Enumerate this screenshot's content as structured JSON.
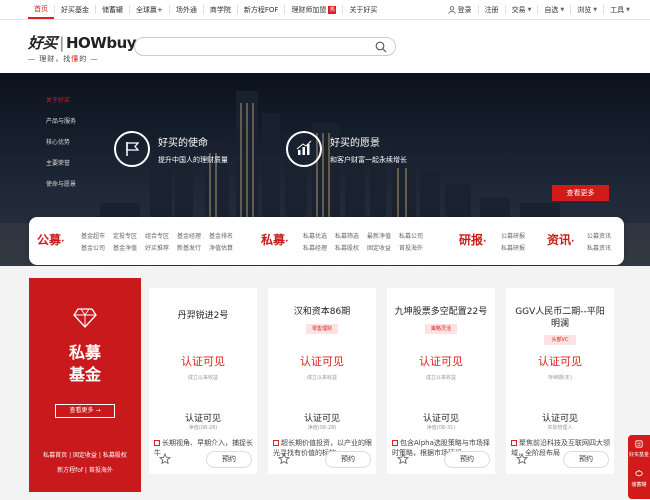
{
  "topnav": {
    "left": [
      {
        "label": "首页",
        "active": true
      },
      {
        "label": "好买基金"
      },
      {
        "label": "储蓄罐"
      },
      {
        "label": "全球赢+"
      },
      {
        "label": "场外通"
      },
      {
        "label": "商学院"
      },
      {
        "label": "新方程FOF"
      },
      {
        "label": "理财师加盟",
        "hot": "热"
      },
      {
        "label": "关于好买"
      }
    ],
    "right": {
      "login": "登录",
      "register": "注册",
      "trade": "交易",
      "watchlist": "自选",
      "history": "浏览",
      "tools": "工具"
    }
  },
  "header": {
    "logo_brand_left": "好买",
    "logo_brand_right": "HOWbuy",
    "slogan_prefix": "理财，找",
    "slogan_emph": "懂",
    "slogan_suffix": "的",
    "search_placeholder": ""
  },
  "hero": {
    "menu": [
      "关于好买",
      "产品与服务",
      "核心优势",
      "主要荣誉",
      "使命与愿景"
    ],
    "mission": {
      "title": "好买的使命",
      "text": "提升中国人的理财质量"
    },
    "vision": {
      "title": "好买的愿景",
      "text": "和客户财富一起永续增长"
    },
    "more_label": "查看更多"
  },
  "band": {
    "public": {
      "title": "公募",
      "links": [
        "基金超市",
        "定投专区",
        "组合专区",
        "基金经理",
        "基金排名",
        "基金公司",
        "基金净值",
        "好买推荐",
        "新基发行",
        "净值估算"
      ]
    },
    "private": {
      "title": "私募",
      "links": [
        "私募优选",
        "私募筛选",
        "最新净值",
        "私募公司",
        "私募经理",
        "私募股权",
        "固定收益",
        "首投海外"
      ]
    },
    "research": {
      "title": "研报",
      "links": [
        "公募研报",
        "私募研报"
      ]
    },
    "news": {
      "title": "资讯",
      "links": [
        "公募资讯",
        "私募资讯"
      ]
    }
  },
  "private_panel": {
    "title_line1": "私募",
    "title_line2": "基金",
    "see_more": "查看更多 →",
    "sub1": "私募首页 | 固定收益 | 私募股权",
    "sub2": "新方程fof | 首投海外"
  },
  "cards": [
    {
      "name": "丹羿锐进2号",
      "tag": "",
      "cert1": "认证可见",
      "label1": "成立以来收益",
      "cert2": "认证可见",
      "label2": "净值(08-28)",
      "desc": "长期视角、早期介入，捕捉长牛",
      "book": "预约"
    },
    {
      "name": "汉和资本86期",
      "tag": "零售理财",
      "cert1": "认证可见",
      "label1": "成立以来收益",
      "cert2": "认证可见",
      "label2": "净值(08-28)",
      "desc": "超长期价值投资，以产业的眼光寻找有价值的标的",
      "book": "预约"
    },
    {
      "name": "九坤股票多空配置22号",
      "tag": "策略灵活",
      "cert1": "认证可见",
      "label1": "成立以来收益",
      "cert2": "认证可见",
      "label2": "净值(08-31)",
      "desc": "包含Alpha选股策略与市场择时策略，根据市场环境",
      "book": "预约"
    },
    {
      "name": "GGV人民币二期--平阳明澜",
      "tag": "头部VC",
      "cert1": "认证可见",
      "label1": "存续期(年)",
      "cert2": "认证可见",
      "label2": "实际管理人",
      "desc": "聚焦前沿科技及互联网四大领域，全阶段布局",
      "book": "预约"
    }
  ],
  "float": {
    "item1": "好买基金",
    "item2": "储蓄罐"
  }
}
